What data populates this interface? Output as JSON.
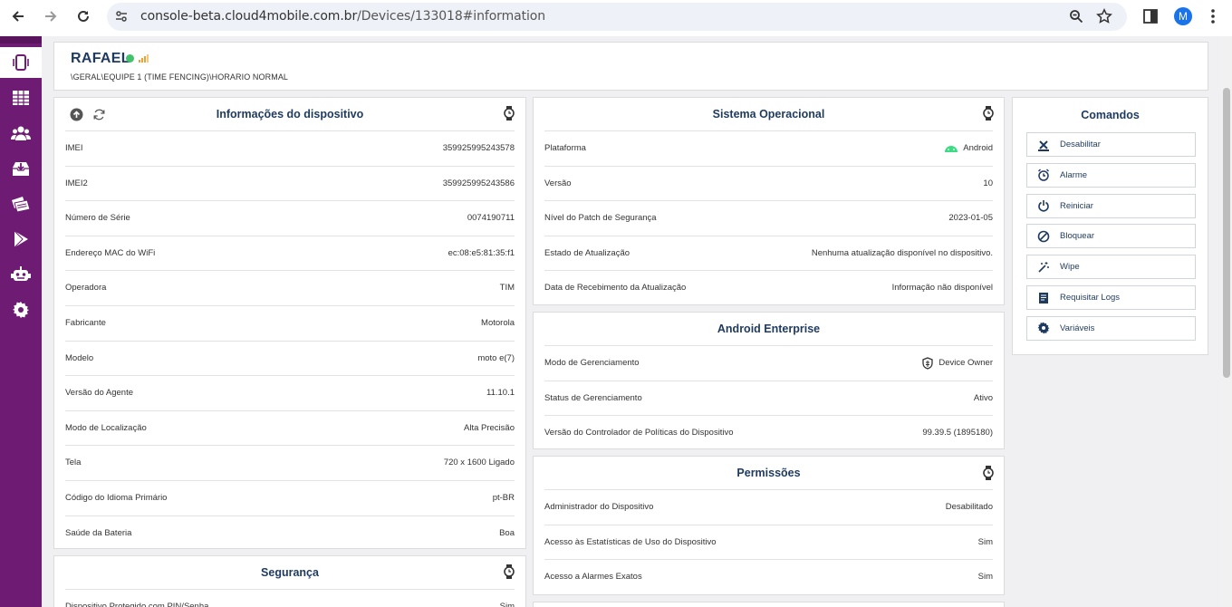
{
  "browser": {
    "url_host": "console-beta.cloud4mobile.com.br",
    "url_path": "/Devices/133018#information",
    "profile_initial": "M"
  },
  "sidebar": {
    "items": [
      {
        "icon": "phone-icon",
        "active": true
      },
      {
        "icon": "table-icon"
      },
      {
        "icon": "users-icon"
      },
      {
        "icon": "inbox-icon"
      },
      {
        "icon": "apps-icon"
      },
      {
        "icon": "play-store-icon"
      },
      {
        "icon": "robot-icon"
      },
      {
        "icon": "gear-icon"
      }
    ]
  },
  "device": {
    "name": "RAFAEL",
    "path": "\\GERAL\\EQUIPE 1 (TIME FENCING)\\HORARIO NORMAL",
    "status_color": "#41c26b"
  },
  "info_card": {
    "title": "Informações do dispositivo",
    "rows": [
      {
        "label": "IMEI",
        "value": "359925995243578"
      },
      {
        "label": "IMEI2",
        "value": "359925995243586"
      },
      {
        "label": "Número de Série",
        "value": "0074190711"
      },
      {
        "label": "Endereço MAC do WiFi",
        "value": "ec:08:e5:81:35:f1"
      },
      {
        "label": "Operadora",
        "value": "TIM"
      },
      {
        "label": "Fabricante",
        "value": "Motorola"
      },
      {
        "label": "Modelo",
        "value": "moto e(7)"
      },
      {
        "label": "Versão do Agente",
        "value": "11.10.1"
      },
      {
        "label": "Modo de Localização",
        "value": "Alta Precisão"
      },
      {
        "label": "Tela",
        "value": "720 x 1600 Ligado"
      },
      {
        "label": "Código do Idioma Primário",
        "value": "pt-BR"
      },
      {
        "label": "Saúde da Bateria",
        "value": "Boa"
      }
    ]
  },
  "security_card": {
    "title": "Segurança",
    "rows": [
      {
        "label": "Dispositivo Protegido com PIN/Senha",
        "value": "Sim"
      }
    ]
  },
  "os_card": {
    "title": "Sistema Operacional",
    "rows": [
      {
        "label": "Plataforma",
        "value": "Android"
      },
      {
        "label": "Versão",
        "value": "10"
      },
      {
        "label": "Nível do Patch de Segurança",
        "value": "2023-01-05"
      },
      {
        "label": "Estado de Atualização",
        "value": "Nenhuma atualização disponível no dispositivo."
      },
      {
        "label": "Data de Recebimento da Atualização",
        "value": "Informação não disponível"
      }
    ]
  },
  "ae_card": {
    "title": "Android Enterprise",
    "rows": [
      {
        "label": "Modo de Gerenciamento",
        "value": "Device Owner"
      },
      {
        "label": "Status de Gerenciamento",
        "value": "Ativo"
      },
      {
        "label": "Versão do Controlador de Políticas do Dispositivo",
        "value": "99.39.5 (1895180)"
      }
    ]
  },
  "perm_card": {
    "title": "Permissões",
    "rows": [
      {
        "label": "Administrador do Dispositivo",
        "value": "Desabilitado"
      },
      {
        "label": "Acesso às Estatísticas de Uso do Dispositivo",
        "value": "Sim"
      },
      {
        "label": "Acesso a Alarmes Exatos",
        "value": "Sim"
      }
    ]
  },
  "commands": {
    "title": "Comandos",
    "items": [
      {
        "label": "Desabilitar",
        "icon": "disable-icon"
      },
      {
        "label": "Alarme",
        "icon": "alarm-icon"
      },
      {
        "label": "Reiniciar",
        "icon": "power-icon"
      },
      {
        "label": "Bloquear",
        "icon": "block-icon"
      },
      {
        "label": "Wipe",
        "icon": "wipe-icon"
      },
      {
        "label": "Requisitar Logs",
        "icon": "logs-icon"
      },
      {
        "label": "Variáveis",
        "icon": "gear-icon"
      }
    ]
  },
  "colors": {
    "sidebar": "#6e1b73",
    "title": "#1e3a5f",
    "android_green": "#3ddc84"
  }
}
